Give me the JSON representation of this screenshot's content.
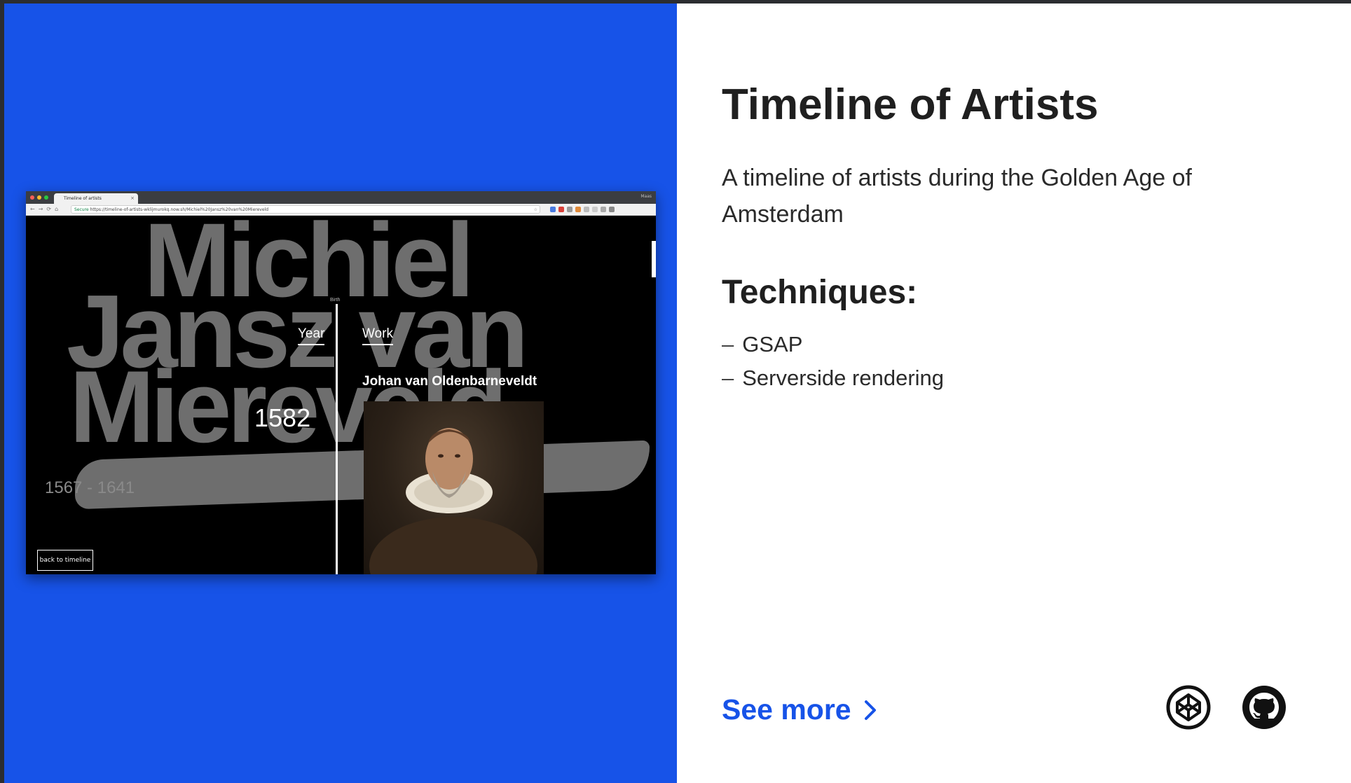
{
  "browser": {
    "tab_title": "Timeline of artists",
    "tab_close": "×",
    "window_label": "Maas",
    "url_secure": "Secure",
    "url_text": "https://timeline-of-artists-wklijmurokq.now.sh/Michiel%20Jansz%20van%20Miereveld",
    "nav_back": "←",
    "nav_forward": "→",
    "nav_reload": "⟳",
    "nav_home": "⌂",
    "bookmark_star": "☆"
  },
  "artist_page": {
    "name_line1": "Michiel",
    "name_line2": "Jansz van",
    "name_line3": "Miereveld",
    "birth_label": "Birth",
    "year_column": "Year",
    "work_column": "Work",
    "work_title": "Johan van Oldenbarneveldt",
    "year": "1582",
    "life_years": "1567 - 1641",
    "back_button": "back to timeline"
  },
  "project": {
    "title": "Timeline of Artists",
    "description": "A timeline of artists during the Golden Age of Amsterdam",
    "techniques_heading": "Techniques:",
    "techniques": [
      "GSAP",
      "Serverside rendering"
    ],
    "dash": "–",
    "see_more": "See more",
    "icons": [
      "codepen-icon",
      "github-icon"
    ]
  },
  "colors": {
    "accent_blue": "#1753e8",
    "text_dark": "#1f1f1f"
  }
}
